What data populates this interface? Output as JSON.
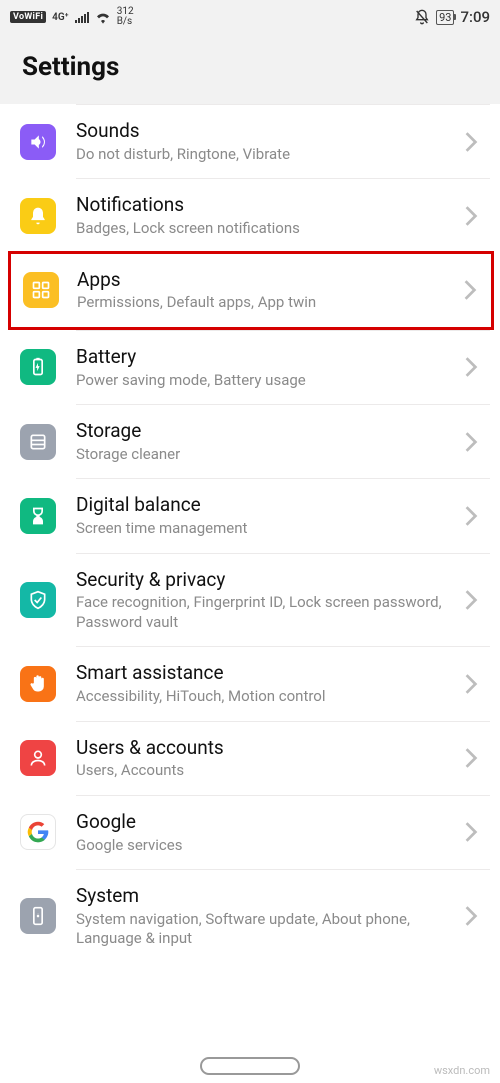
{
  "status": {
    "vowifi": "VoWiFi",
    "net4g": "4G⁺",
    "speed_top": "312",
    "speed_bot": "B/s",
    "battery": "93",
    "time": "7:09"
  },
  "header": {
    "title": "Settings"
  },
  "items": [
    {
      "id": "sounds",
      "title": "Sounds",
      "sub": "Do not disturb, Ringtone, Vibrate"
    },
    {
      "id": "notifications",
      "title": "Notifications",
      "sub": "Badges, Lock screen notifications"
    },
    {
      "id": "apps",
      "title": "Apps",
      "sub": "Permissions, Default apps, App twin"
    },
    {
      "id": "battery",
      "title": "Battery",
      "sub": "Power saving mode, Battery usage"
    },
    {
      "id": "storage",
      "title": "Storage",
      "sub": "Storage cleaner"
    },
    {
      "id": "digital",
      "title": "Digital balance",
      "sub": "Screen time management"
    },
    {
      "id": "security",
      "title": "Security & privacy",
      "sub": "Face recognition, Fingerprint ID, Lock screen password, Password vault"
    },
    {
      "id": "smart",
      "title": "Smart assistance",
      "sub": "Accessibility, HiTouch, Motion control"
    },
    {
      "id": "users",
      "title": "Users & accounts",
      "sub": "Users, Accounts"
    },
    {
      "id": "google",
      "title": "Google",
      "sub": "Google services"
    },
    {
      "id": "system",
      "title": "System",
      "sub": "System navigation, Software update, About phone, Language & input"
    }
  ],
  "watermark": "wsxdn.com"
}
